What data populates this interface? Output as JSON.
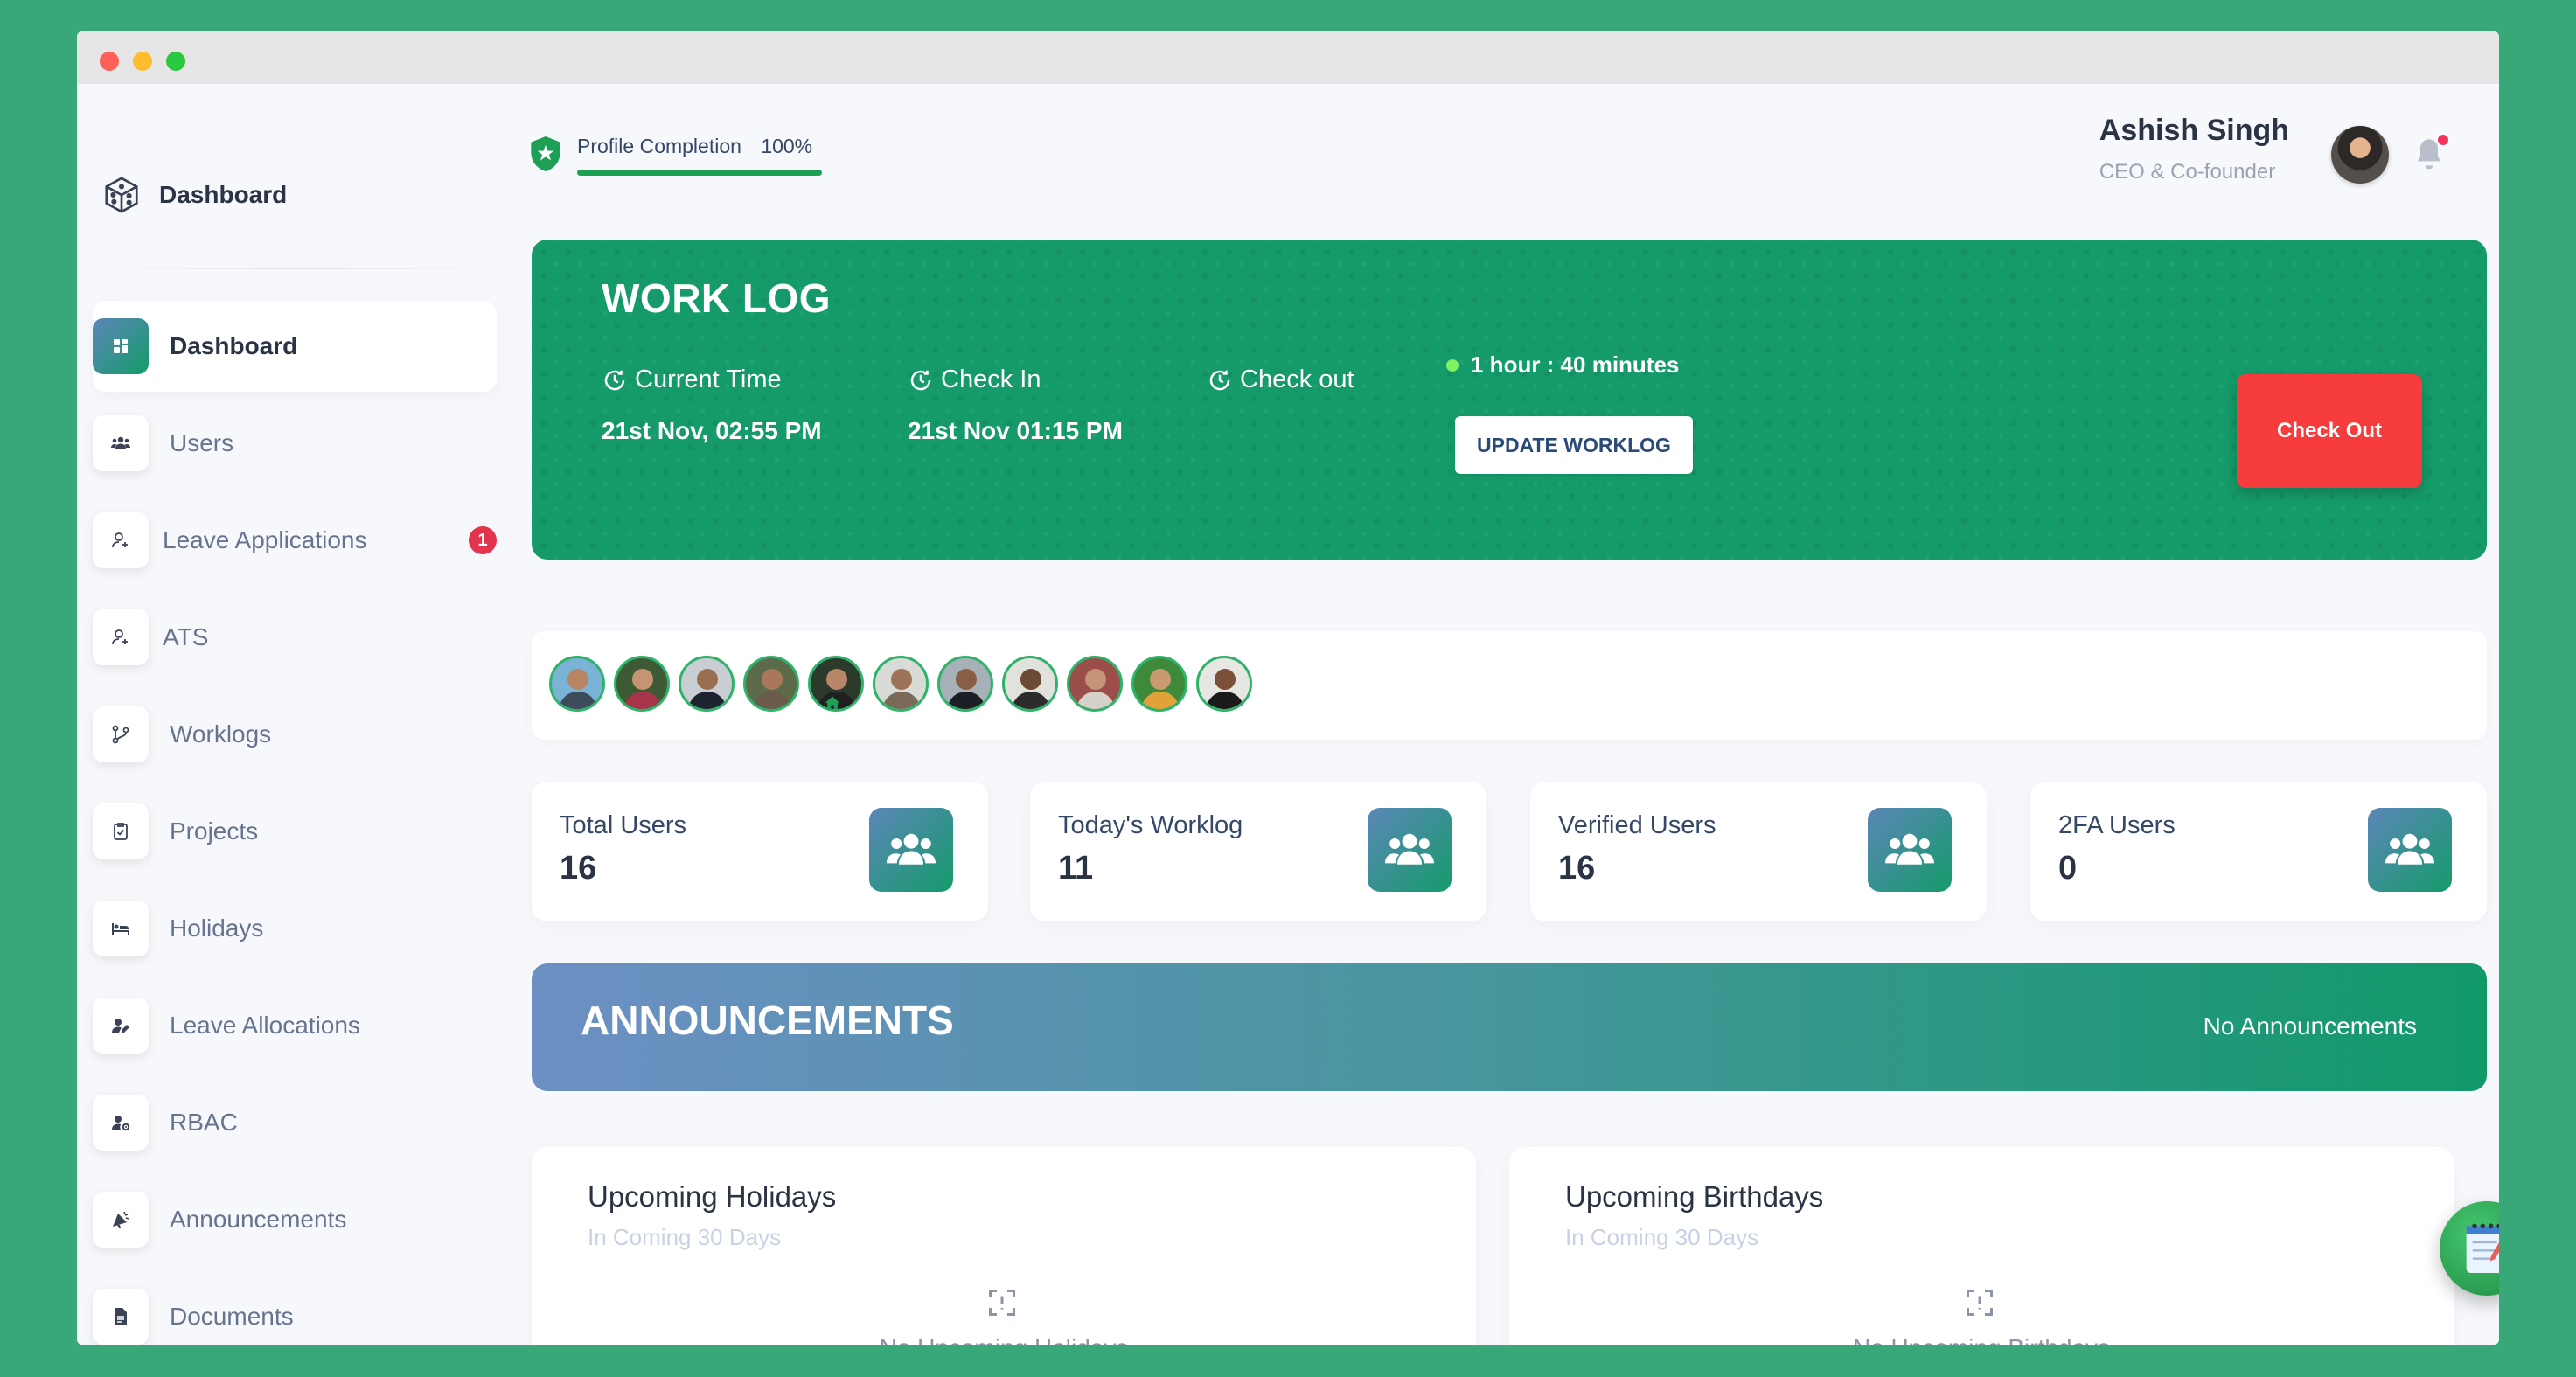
{
  "sidebar": {
    "brand": "Dashboard",
    "items": [
      {
        "label": "Dashboard",
        "icon": "grid-icon",
        "active": true
      },
      {
        "label": "Users",
        "icon": "users-icon"
      },
      {
        "label": "Leave Applications",
        "icon": "user-add-icon",
        "badge": "1"
      },
      {
        "label": "ATS",
        "icon": "user-add-icon"
      },
      {
        "label": "Worklogs",
        "icon": "branch-icon"
      },
      {
        "label": "Projects",
        "icon": "clipboard-icon"
      },
      {
        "label": "Holidays",
        "icon": "bed-icon"
      },
      {
        "label": "Leave Allocations",
        "icon": "user-edit-icon"
      },
      {
        "label": "RBAC",
        "icon": "user-gear-icon"
      },
      {
        "label": "Announcements",
        "icon": "megaphone-icon"
      },
      {
        "label": "Documents",
        "icon": "document-icon"
      }
    ]
  },
  "header": {
    "profile_completion_label": "Profile Completion",
    "profile_completion_value": "100%",
    "profile_completion_fraction": 1.0,
    "user_name": "Ashish Singh",
    "user_role": "CEO & Co-founder"
  },
  "worklog": {
    "title": "WORK LOG",
    "current_time_label": "Current Time",
    "current_time_value": "21st Nov, 02:55 PM",
    "check_in_label": "Check In",
    "check_in_value": "21st Nov 01:15 PM",
    "check_out_label": "Check out",
    "duration": "1 hour : 40 minutes",
    "update_button": "UPDATE WORKLOG",
    "checkout_button": "Check Out"
  },
  "team_avatars_count": 11,
  "stats": [
    {
      "label": "Total Users",
      "value": "16"
    },
    {
      "label": "Today's Worklog",
      "value": "11"
    },
    {
      "label": "Verified Users",
      "value": "16"
    },
    {
      "label": "2FA Users",
      "value": "0"
    }
  ],
  "announcements": {
    "title": "ANNOUNCEMENTS",
    "empty_text": "No Announcements"
  },
  "holidays": {
    "title": "Upcoming Holidays",
    "subtitle": "In Coming 30 Days",
    "empty_text": "No Upcoming Holidays"
  },
  "birthdays": {
    "title": "Upcoming Birthdays",
    "subtitle": "In Coming 30 Days",
    "empty_text": "No Upcoming Birthdays"
  },
  "colors": {
    "primary_green": "#159b6a",
    "accent_red": "#f63c3c",
    "badge_red": "#e2344c",
    "background": "#38a878"
  }
}
